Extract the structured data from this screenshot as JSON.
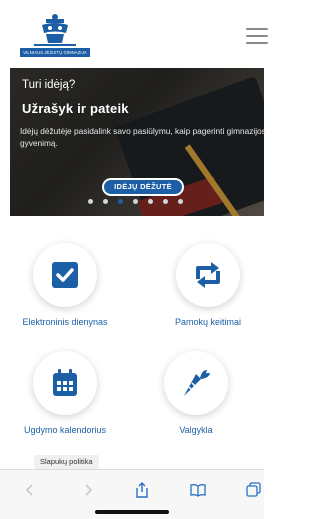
{
  "header": {
    "logo_text": "VILNIAUS JĖZUITŲ GIMNAZIJA",
    "logo_alt": "school-crest"
  },
  "hero": {
    "kicker": "Turi idėją?",
    "title": "Užrašyk ir pateik",
    "body": "Idėjų dėžutėje pasidalink savo pasiūlymu, kaip pagerinti gimnazijos gyvenimą.",
    "button_label": "IDĖJŲ DĖŽUTĖ",
    "slides_total": 7,
    "active_slide": 2
  },
  "tiles": [
    {
      "label": "Elektroninis dienynas",
      "icon": "checkbox-icon"
    },
    {
      "label": "Pamokų keitimai",
      "icon": "swap-arrows-icon"
    },
    {
      "label": "Ugdymo kalendorius",
      "icon": "calendar-icon"
    },
    {
      "label": "Valgykla",
      "icon": "carrot-icon"
    }
  ],
  "cookie": {
    "label": "Slapukų politika"
  },
  "toolbar": {
    "icons": [
      "back-icon",
      "forward-icon",
      "share-icon",
      "bookmarks-icon",
      "tabs-icon"
    ]
  },
  "colors": {
    "accent": "#1d5fa6",
    "label": "#1d5fa6"
  }
}
